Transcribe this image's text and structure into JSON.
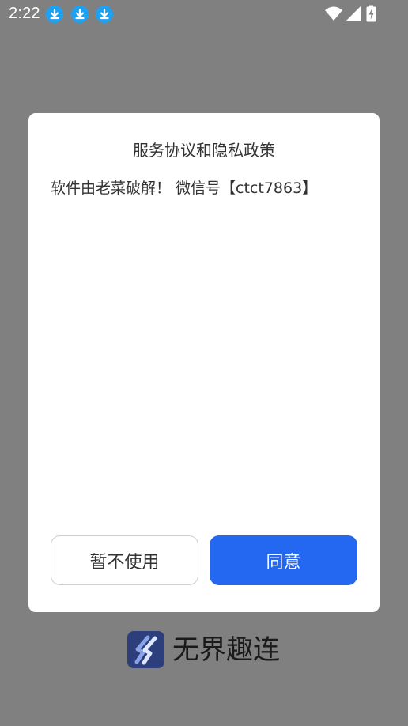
{
  "status_bar": {
    "time": "2:22",
    "notification_icons": [
      "download-icon",
      "download-icon",
      "download-icon"
    ],
    "system_icons": [
      "wifi-icon",
      "cell-signal-icon",
      "battery-charging-icon"
    ]
  },
  "dialog": {
    "title": "服务协议和隐私政策",
    "message": "软件由老菜破解！ 微信号【ctct7863】",
    "decline_label": "暂不使用",
    "agree_label": "同意"
  },
  "brand": {
    "logo_icon": "lightning-logo-icon",
    "name": "无界趣连"
  },
  "colors": {
    "scrim": "#808080",
    "primary": "#2468f2",
    "download_badge": "#1da1f2",
    "logo_bg": "#2c3e7c"
  }
}
